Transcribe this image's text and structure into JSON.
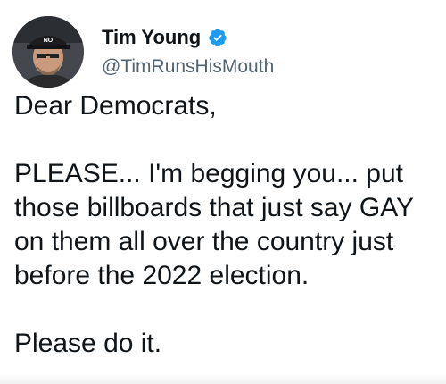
{
  "tweet": {
    "author": {
      "display_name": "Tim Young",
      "handle": "@TimRunsHisMouth",
      "verified": true,
      "avatar_icon": "profile-photo",
      "hat_text": "NO"
    },
    "body": {
      "greeting": "Dear Democrats,",
      "paragraph": "PLEASE... I'm begging you... put those billboards that just say GAY on them all over the country just before the 2022 election.",
      "closing": "Please do it."
    }
  },
  "colors": {
    "text_primary": "#0f1419",
    "text_secondary": "#536471",
    "verified_blue": "#1d9bf0",
    "background": "#ffffff"
  }
}
